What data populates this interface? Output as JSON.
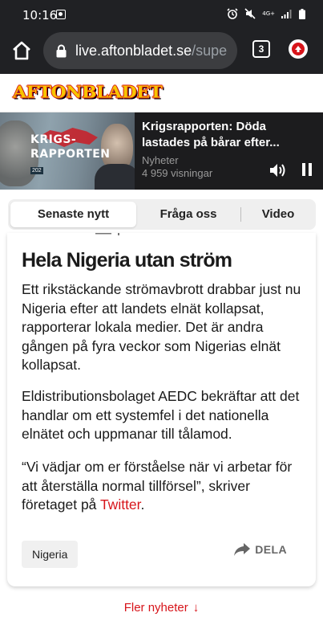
{
  "status_bar": {
    "time": "10:16",
    "network": "4G+",
    "icons": [
      "photo-notification-icon",
      "alarm-icon",
      "mute-icon",
      "network-4g-icon",
      "signal-icon",
      "battery-icon"
    ]
  },
  "browser": {
    "url_host": "live.aftonbladet.se",
    "url_path": "/supe",
    "tab_count": "3",
    "icons": [
      "home-icon",
      "lock-icon",
      "extension-icon"
    ]
  },
  "site": {
    "logo_text": "AFTONBLADET"
  },
  "player": {
    "thumb_title_line1": "KRIGS-",
    "thumb_title_line2": "RAPPORTEN",
    "thumb_year": "202",
    "title": "Krigsrapporten: Döda lastades på bårar efter...",
    "category": "Nyheter",
    "views": "4 959 visningar"
  },
  "tabs": {
    "items": [
      {
        "label": "Senaste nytt",
        "active": true
      },
      {
        "label": "Fråga oss",
        "active": false
      },
      {
        "label": "Video",
        "active": false
      }
    ]
  },
  "article": {
    "headline": "Hela Nigeria utan ström",
    "paragraph1": "Ett rikstäckande strömavbrott drabbar just nu Nigeria efter att landets elnät kollapsat, rapporterar lokala medier. Det är andra gången på fyra veckor som Nigerias elnät kollapsat.",
    "paragraph2": "Eldistributionsbolaget AEDC bekräftar att det handlar om ett systemfel i det nationella elnätet och uppmanar till tålamod.",
    "paragraph3_before": "“Vi vädjar om er förståelse när vi arbetar för att återställa normal tillförsel”, skriver företaget på ",
    "paragraph3_link": "Twitter",
    "paragraph3_after": ".",
    "tag": "Nigeria",
    "share_label": "DELA"
  },
  "footer": {
    "more_label": "Fler nyheter",
    "more_arrow": "↓"
  },
  "colors": {
    "accent_red": "#d7141a",
    "logo_yellow": "#f6c500",
    "browser_bar": "#202124"
  }
}
